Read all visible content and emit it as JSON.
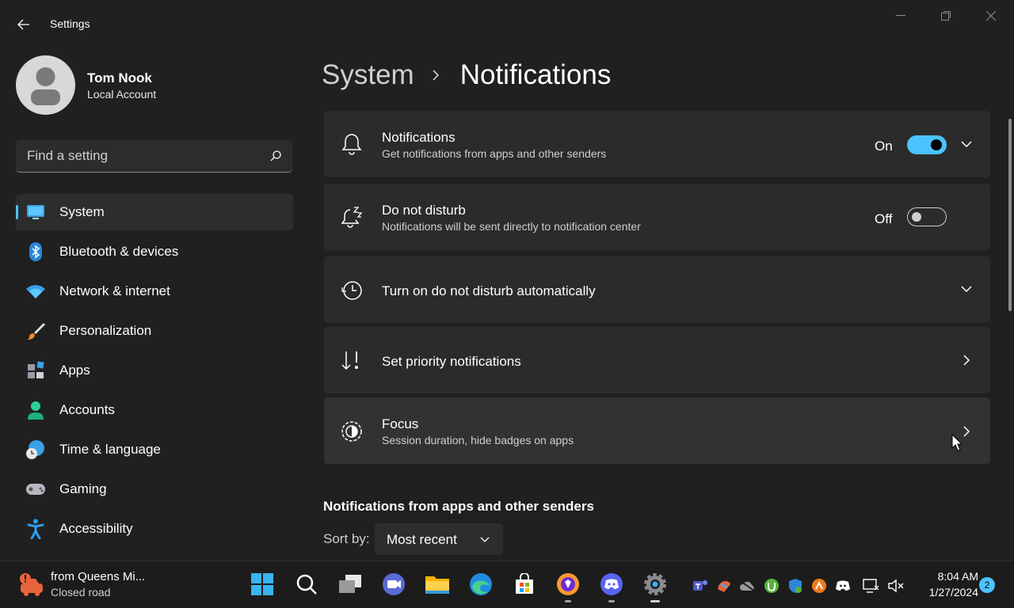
{
  "window": {
    "title": "Settings"
  },
  "profile": {
    "name": "Tom Nook",
    "account_type": "Local Account"
  },
  "search": {
    "placeholder": "Find a setting"
  },
  "nav": {
    "items": [
      {
        "label": "System",
        "icon": "system-icon",
        "active": true
      },
      {
        "label": "Bluetooth & devices",
        "icon": "bluetooth-icon"
      },
      {
        "label": "Network & internet",
        "icon": "wifi-icon"
      },
      {
        "label": "Personalization",
        "icon": "brush-icon"
      },
      {
        "label": "Apps",
        "icon": "apps-icon"
      },
      {
        "label": "Accounts",
        "icon": "person-icon"
      },
      {
        "label": "Time & language",
        "icon": "globe-clock-icon"
      },
      {
        "label": "Gaming",
        "icon": "gamepad-icon"
      },
      {
        "label": "Accessibility",
        "icon": "accessibility-icon"
      }
    ]
  },
  "breadcrumb": {
    "parent": "System",
    "current": "Notifications"
  },
  "cards": [
    {
      "title": "Notifications",
      "subtitle": "Get notifications from apps and other senders",
      "toggle_label": "On",
      "toggle_on": true,
      "icon": "bell-icon"
    },
    {
      "title": "Do not disturb",
      "subtitle": "Notifications will be sent directly to notification center",
      "toggle_label": "Off",
      "toggle_on": false,
      "icon": "bell-snooze-icon"
    },
    {
      "title": "Turn on do not disturb automatically",
      "icon": "clock-icon"
    },
    {
      "title": "Set priority notifications",
      "icon": "priority-sort-icon"
    },
    {
      "title": "Focus",
      "subtitle": "Session duration, hide badges on apps",
      "icon": "focus-icon"
    }
  ],
  "section": {
    "title": "Notifications from apps and other senders"
  },
  "sort": {
    "label": "Sort by:",
    "value": "Most recent"
  },
  "taskbar": {
    "weather": {
      "title": "from Queens Mi...",
      "subtitle": "Closed road"
    },
    "clock": {
      "time": "8:04 AM",
      "date": "1/27/2024"
    },
    "notification_count": "2",
    "apps": [
      "start-icon",
      "search-icon",
      "task-view-icon",
      "zoom-icon",
      "file-explorer-icon",
      "edge-icon",
      "store-icon",
      "brave-icon",
      "discord-icon",
      "settings-icon"
    ]
  },
  "colors": {
    "accent": "#4cc2ff",
    "background": "#202020",
    "card": "#2b2b2b"
  }
}
